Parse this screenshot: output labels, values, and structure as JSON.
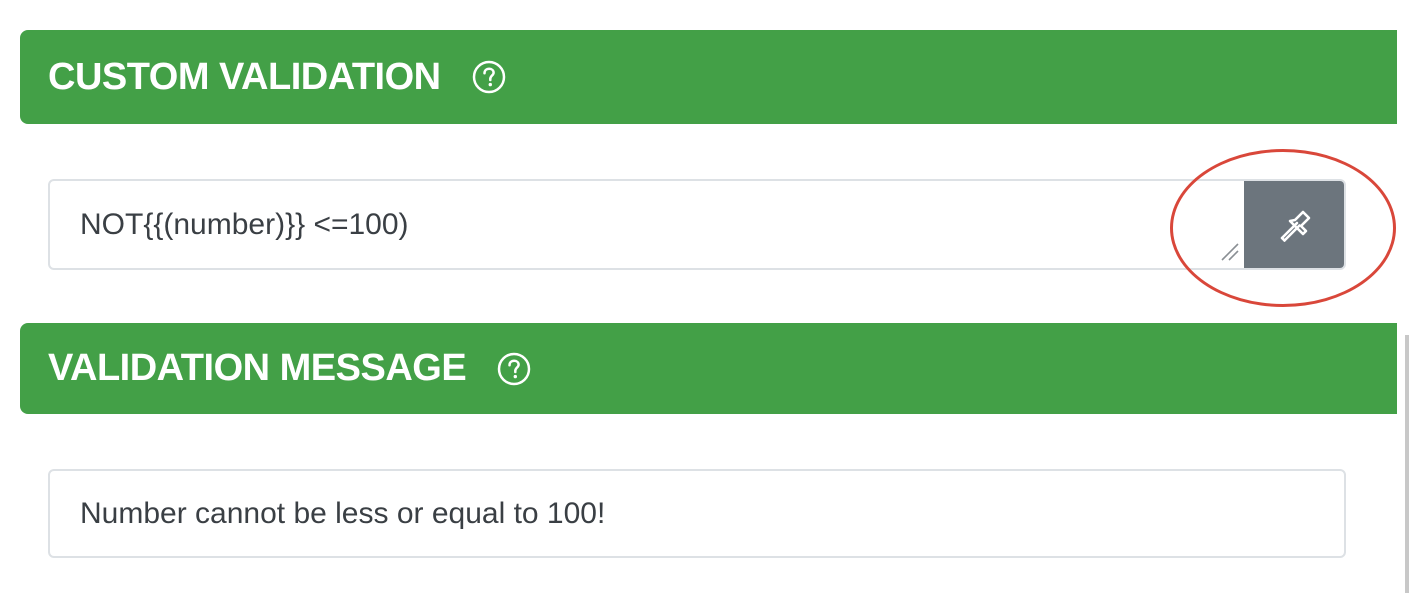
{
  "sections": {
    "custom_validation": {
      "title": "CUSTOM VALIDATION",
      "help_icon": "help-circle-icon",
      "expression_value": "NOT{{(number)}} <=100)",
      "tool_button_icon": "wrench-icon"
    },
    "validation_message": {
      "title": "VALIDATION MESSAGE",
      "help_icon": "help-circle-icon",
      "message_value": "Number cannot be less or equal to 100!"
    }
  },
  "colors": {
    "header_green": "#43a047",
    "tool_button_gray": "#6c757d",
    "annotation_red": "#d9473a"
  }
}
